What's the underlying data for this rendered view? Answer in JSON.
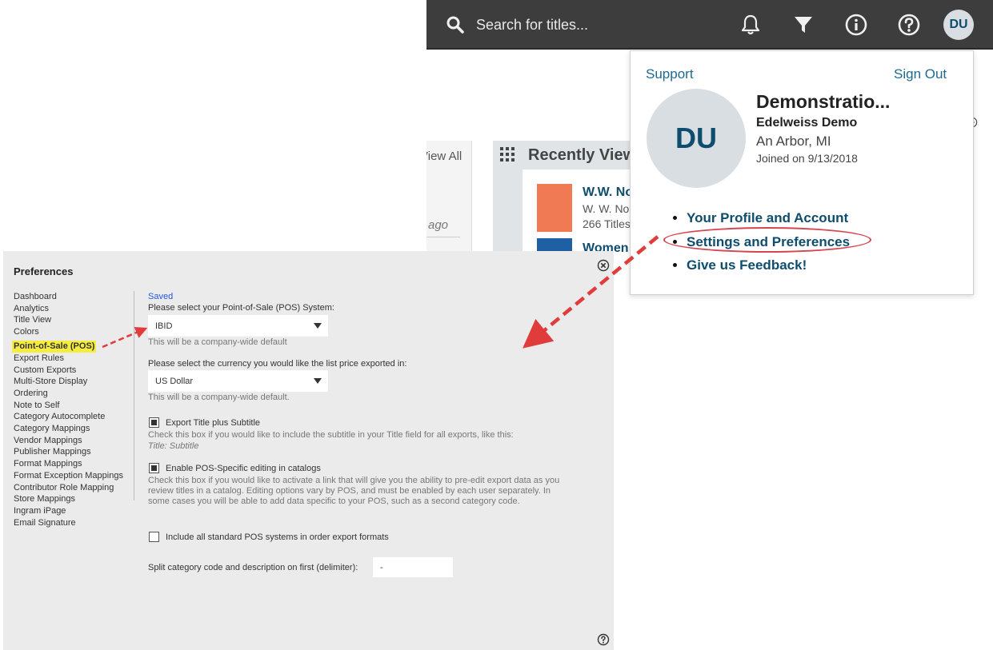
{
  "topbar": {
    "search_placeholder": "Search for titles...",
    "avatar_initials": "DU"
  },
  "background": {
    "view_all": "View All",
    "ago": "ago",
    "recent_title": "Recently Viewed",
    "book1_title": "W.W. Norton",
    "book1_pub": "W. W. Norton",
    "book1_count": "266 Titles",
    "book2_title": "Women"
  },
  "dropdown": {
    "support": "Support",
    "sign_out": "Sign Out",
    "avatar_initials": "DU",
    "name": "Demonstratio...",
    "company": "Edelweiss Demo",
    "location": "An Arbor, MI",
    "joined": "Joined on 9/13/2018",
    "menu": [
      "Your Profile and Account",
      "Settings and Preferences",
      "Give us Feedback!"
    ]
  },
  "prefs": {
    "title": "Preferences",
    "nav": [
      "Dashboard",
      "Analytics",
      "Title View",
      "Colors",
      "Point-of-Sale (POS)",
      "Export Rules",
      "Custom Exports",
      "Multi-Store Display",
      "Ordering",
      "Note to Self",
      "Category Autocomplete",
      "Category Mappings",
      "Vendor Mappings",
      "Publisher Mappings",
      "Format Mappings",
      "Format Exception Mappings",
      "Contributor Role Mapping",
      "Store Mappings",
      "Ingram iPage",
      "Email Signature"
    ],
    "active_nav": "Point-of-Sale (POS)",
    "saved": "Saved",
    "pos_label": "Please select your Point-of-Sale (POS) System:",
    "pos_value": "IBID",
    "pos_note": "This will be a company-wide default",
    "currency_label": "Please select the currency you would like the list price exported in:",
    "currency_value": "US Dollar",
    "currency_note": "This will be a company-wide default.",
    "export_subtitle_label": "Export Title plus Subtitle",
    "export_subtitle_checked": true,
    "export_subtitle_desc": "Check this box if you would like to include the subtitle in your Title field for all exports, like this:",
    "export_subtitle_example": "Title: Subtitle",
    "pos_editing_label": "Enable POS-Specific editing in catalogs",
    "pos_editing_checked": true,
    "pos_editing_desc": "Check this box if you would like to activate a link that will give you the ability to pre-edit export data as you review titles in a catalog. Editing options vary by POS, and must be enabled by each user separately. In some cases you will be able to add data specific to your POS, such as a second category code.",
    "include_std_label": "Include all standard POS systems in order export formats",
    "include_std_checked": false,
    "delimiter_label": "Split category code and description on first (delimiter):",
    "delimiter_value": "-"
  },
  "colors": {
    "topbar": "#3d3d3d",
    "link": "#1d6a8f",
    "menu_link": "#0e4d6d",
    "highlight": "#f5ec3e",
    "arrow": "#e03c3c"
  }
}
